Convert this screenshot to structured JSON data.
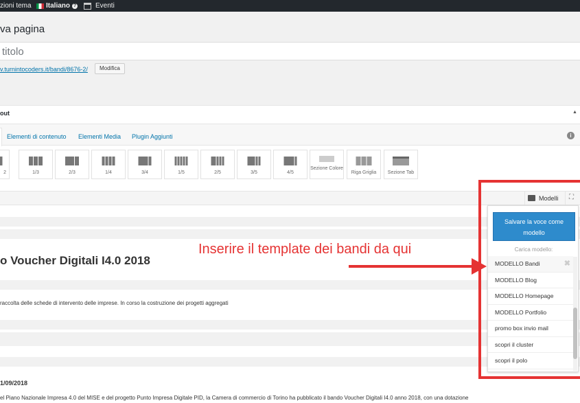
{
  "adminbar": {
    "items": [
      {
        "label": "zioni tema"
      },
      {
        "label": "Italiano"
      },
      {
        "label": "Eventi"
      }
    ]
  },
  "page": {
    "title": "va pagina",
    "title_placeholder": "titolo",
    "permalink": "v.turnintocoders.it/bandi/8676-2/",
    "modifica_label": "Modifica"
  },
  "builder": {
    "header": "out",
    "tabs": [
      {
        "label": "Elementi di contenuto"
      },
      {
        "label": "Elementi Media"
      },
      {
        "label": "Plugin Aggiunti"
      }
    ],
    "elements": [
      {
        "label": "2"
      },
      {
        "label": "1/3"
      },
      {
        "label": "2/3"
      },
      {
        "label": "1/4"
      },
      {
        "label": "3/4"
      },
      {
        "label": "1/5"
      },
      {
        "label": "2/5"
      },
      {
        "label": "3/5"
      },
      {
        "label": "4/5"
      },
      {
        "label": "Sezione Colore"
      },
      {
        "label": "Riga Griglia"
      },
      {
        "label": "Sezione Tab"
      }
    ],
    "modelli_label": "Modelli"
  },
  "content": {
    "heading": "o Voucher Digitali I4.0 2018",
    "description": "raccolta delle schede di intervento delle imprese. In corso la costruzione dei progetti aggregati",
    "date": "1/09/2018",
    "body": "el Piano Nazionale Impresa 4.0 del MISE e del progetto Punto Impresa Digitale PID, la Camera di commercio di Torino ha pubblicato il bando Voucher Digitali I4.0 anno 2018, con una dotazione"
  },
  "annotation": {
    "text": "Inserire il template dei bandi da qui",
    "color": "#e53333"
  },
  "dropdown": {
    "save_label": "Salvare la voce come modello",
    "carica_label": "Carica modello:",
    "items": [
      {
        "label": "MODELLO Bandi"
      },
      {
        "label": "MODELLO Blog"
      },
      {
        "label": "MODELLO Homepage"
      },
      {
        "label": "MODELLO Portfolio"
      },
      {
        "label": "promo box invio mail"
      },
      {
        "label": "scopri il cluster"
      },
      {
        "label": "scopri il polo"
      }
    ],
    "delete_icon": "✖"
  },
  "colors": {
    "accent": "#2e8bcc",
    "adminbar": "#23282d",
    "link": "#0073aa"
  }
}
